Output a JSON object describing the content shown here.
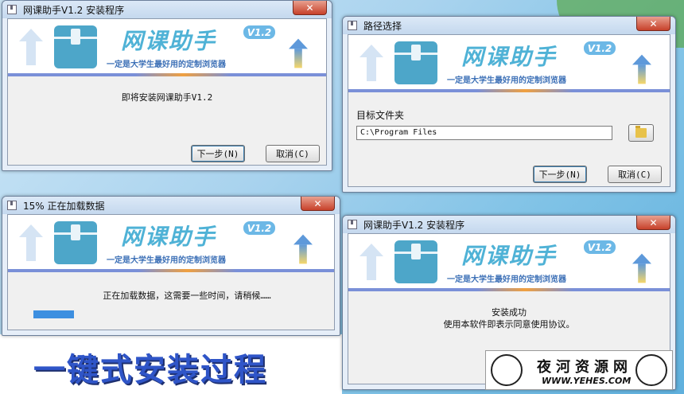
{
  "brand": {
    "title": "网课助手",
    "version": "V1.2",
    "subtitle": "一定是大学生最好用的定制浏览器"
  },
  "windows": {
    "w1": {
      "title": "网课助手V1.2 安装程序",
      "close": "✕",
      "message": "即将安装网课助手V1.2",
      "next": "下一步(N)",
      "cancel": "取消(C)"
    },
    "w2": {
      "title": "路径选择",
      "close": "✕",
      "label": "目标文件夹",
      "path": "C:\\Program Files",
      "next": "下一步(N)",
      "cancel": "取消(C)"
    },
    "w3": {
      "title": "15% 正在加载数据",
      "close": "✕",
      "message": "正在加载数据，这需要一些时间，请稍候……",
      "progress_percent": 15
    },
    "w4": {
      "title": "网课助手V1.2 安装程序",
      "close": "✕",
      "line1": "安装成功",
      "line2": "使用本软件即表示同意使用协议。"
    }
  },
  "caption": "一键式安装过程",
  "watermark": {
    "name": "夜河资源网",
    "url": "WWW.YEHES.COM"
  },
  "colors": {
    "accent": "#4fb2d6",
    "progress": "#3d8fe0",
    "caption": "#2f55c8"
  }
}
